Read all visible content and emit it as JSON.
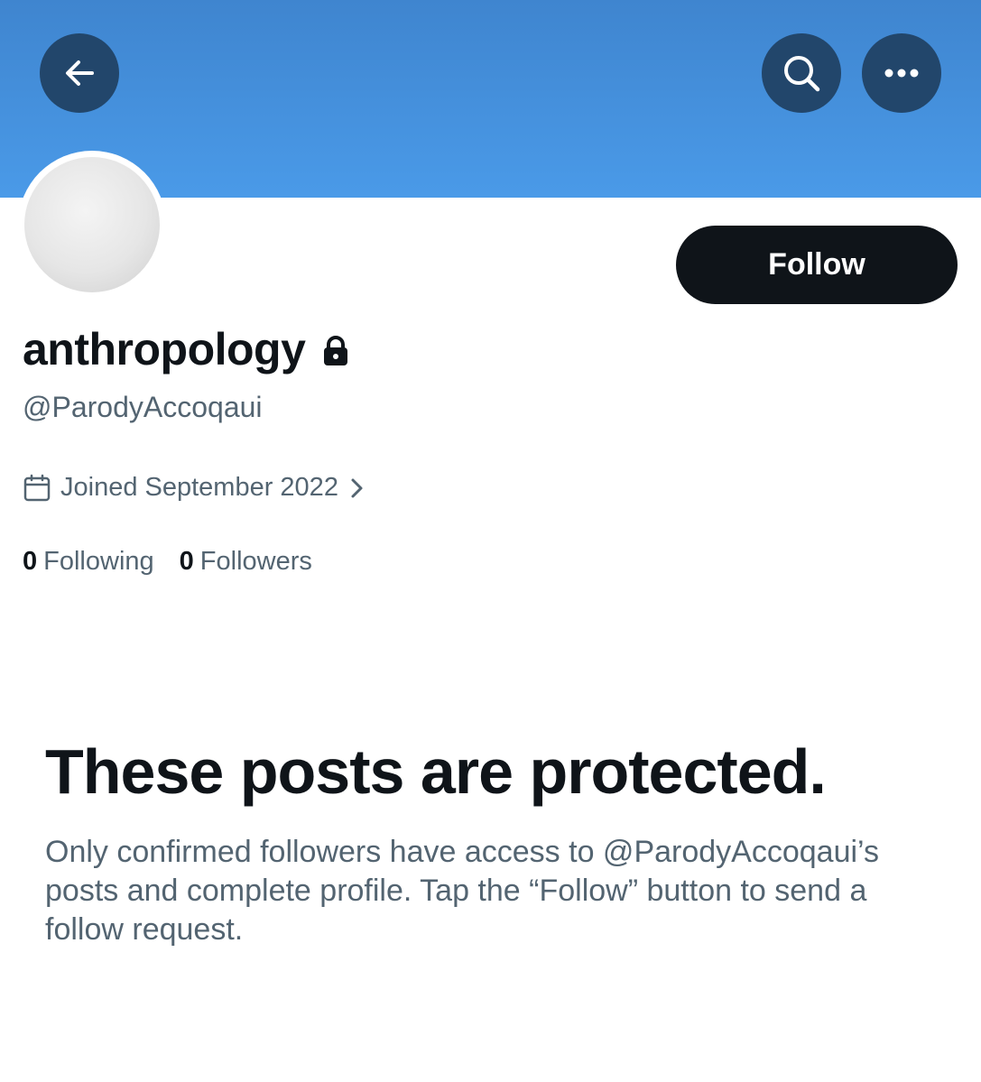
{
  "header": {
    "back_icon": "arrow-left-icon",
    "search_icon": "search-icon",
    "more_icon": "more-horizontal-icon",
    "banner_color": "#4a9ae8"
  },
  "profile": {
    "display_name": "anthropology",
    "protected_icon": "lock-icon",
    "handle": "@ParodyAccoqaui",
    "joined": "Joined September 2022",
    "following_count": "0",
    "following_label": "Following",
    "followers_count": "0",
    "followers_label": "Followers"
  },
  "actions": {
    "follow_label": "Follow"
  },
  "protected_notice": {
    "title": "These posts are protected.",
    "body": "Only confirmed followers have access to @ParodyAccoqaui’s posts and complete profile. Tap the “Follow” button to send a follow request."
  }
}
